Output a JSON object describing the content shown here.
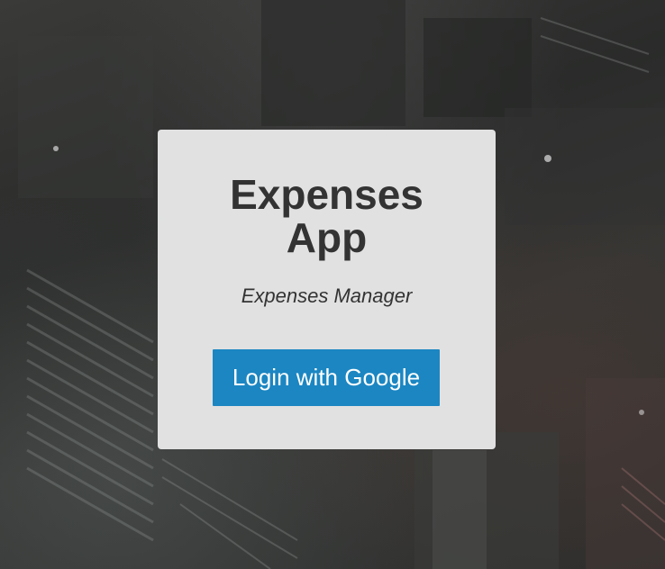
{
  "app": {
    "title_line1": "Expenses",
    "title_line2": "App",
    "subtitle": "Expenses Manager"
  },
  "actions": {
    "login_label": "Login with Google"
  },
  "colors": {
    "card_background": "#e8e8e8",
    "title_text": "#333333",
    "button_background": "#1b86c2",
    "button_text": "#ffffff"
  }
}
